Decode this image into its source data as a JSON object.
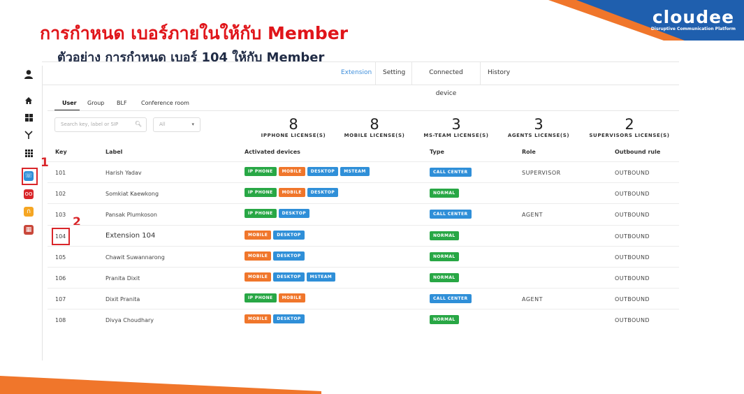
{
  "title": "การกำหนด เบอร์ภายในให้กับ Member",
  "subtitle": "ตัวอย่าง การกำหนด เบอร์ 104 ให้กับ Member",
  "logo": {
    "name": "cloudee",
    "tagline": "Disruptive Communication Platform"
  },
  "colors": {
    "accent_red": "#e0151a",
    "brand_blue": "#2f8fd8",
    "brand_orange": "#f0762b",
    "green": "#28a745"
  },
  "markers": {
    "one": "1",
    "two": "2"
  },
  "sidebar": {
    "items": [
      {
        "icon": "user-icon"
      },
      {
        "icon": "home-icon"
      },
      {
        "icon": "grid-icon"
      },
      {
        "icon": "routing-icon"
      },
      {
        "icon": "apps-icon"
      },
      {
        "icon": "extension-phone-icon"
      },
      {
        "icon": "voicemail-icon"
      },
      {
        "icon": "headset-icon"
      },
      {
        "icon": "calendar-icon"
      }
    ]
  },
  "topnav": {
    "tabs": [
      "Extension",
      "Setting",
      "Connected device",
      "History"
    ],
    "active": "Extension"
  },
  "subtabs": {
    "items": [
      "User",
      "Group",
      "BLF",
      "Conference room"
    ],
    "active": "User"
  },
  "search": {
    "placeholder": "Search key, label or SIP",
    "filter_value": "All"
  },
  "licenses": [
    {
      "count": "8",
      "label": "IPPHONE LICENSE(S)"
    },
    {
      "count": "8",
      "label": "MOBILE LICENSE(S)"
    },
    {
      "count": "3",
      "label": "MS-TEAM LICENSE(S)"
    },
    {
      "count": "3",
      "label": "AGENTS LICENSE(S)"
    },
    {
      "count": "2",
      "label": "SUPERVISORS LICENSE(S)"
    }
  ],
  "table": {
    "headers": [
      "Key",
      "Label",
      "Activated devices",
      "Type",
      "Role",
      "Outbound rule"
    ],
    "rows": [
      {
        "key": "101",
        "label": "Harish Yadav",
        "devices": [
          "IP PHONE",
          "MOBILE",
          "DESKTOP",
          "MSTEAM"
        ],
        "type": "CALL CENTER",
        "role": "SUPERVISOR",
        "outbound": "OUTBOUND"
      },
      {
        "key": "102",
        "label": "Somkiat Kaewkong",
        "devices": [
          "IP PHONE",
          "MOBILE",
          "DESKTOP"
        ],
        "type": "NORMAL",
        "role": "",
        "outbound": "OUTBOUND"
      },
      {
        "key": "103",
        "label": "Pansak Plumkoson",
        "devices": [
          "IP PHONE",
          "DESKTOP"
        ],
        "type": "CALL CENTER",
        "role": "AGENT",
        "outbound": "OUTBOUND"
      },
      {
        "key": "104",
        "label": "Extension 104",
        "devices": [
          "MOBILE",
          "DESKTOP"
        ],
        "type": "NORMAL",
        "role": "",
        "outbound": "OUTBOUND"
      },
      {
        "key": "105",
        "label": "Chawit Suwannarong",
        "devices": [
          "MOBILE",
          "DESKTOP"
        ],
        "type": "NORMAL",
        "role": "",
        "outbound": "OUTBOUND"
      },
      {
        "key": "106",
        "label": "Pranita Dixit",
        "devices": [
          "MOBILE",
          "DESKTOP",
          "MSTEAM"
        ],
        "type": "NORMAL",
        "role": "",
        "outbound": "OUTBOUND"
      },
      {
        "key": "107",
        "label": "Dixit Pranita",
        "devices": [
          "IP PHONE",
          "MOBILE"
        ],
        "type": "CALL CENTER",
        "role": "AGENT",
        "outbound": "OUTBOUND"
      },
      {
        "key": "108",
        "label": "Divya Choudhary",
        "devices": [
          "MOBILE",
          "DESKTOP"
        ],
        "type": "NORMAL",
        "role": "",
        "outbound": "OUTBOUND"
      }
    ]
  }
}
